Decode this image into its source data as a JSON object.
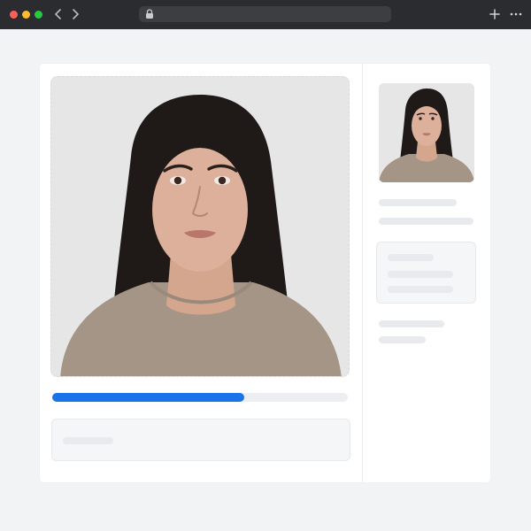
{
  "window": {
    "traffic_lights": {
      "close": "#ff5f57",
      "minimize": "#febc2e",
      "zoom": "#28c840"
    },
    "address_bar": {
      "url": ""
    },
    "icons": [
      "chevron-left-icon",
      "chevron-right-icon",
      "lock-icon",
      "plus-icon",
      "more-icon"
    ]
  },
  "main": {
    "photo": {
      "alt": ""
    },
    "upload_progress": {
      "percent": 65,
      "color": "#1a73e8"
    },
    "info_box": {
      "text": ""
    }
  },
  "sidebar": {
    "thumbnail": {
      "alt": ""
    }
  }
}
